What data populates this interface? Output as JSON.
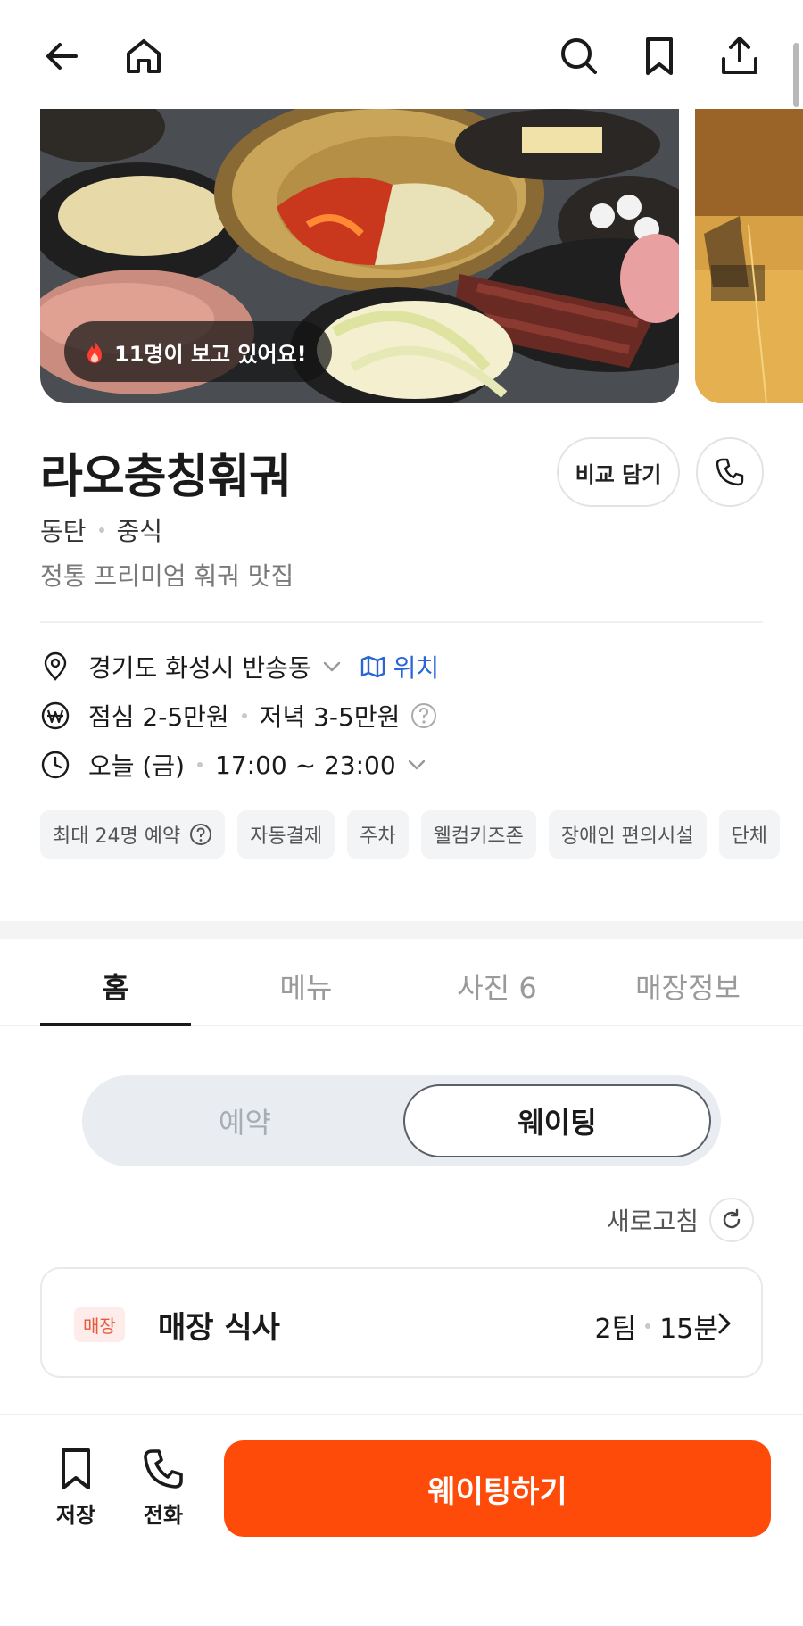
{
  "header": {
    "back_icon": "arrow-left-icon",
    "home_icon": "home-icon",
    "search_icon": "search-icon",
    "bookmark_icon": "bookmark-icon",
    "share_icon": "share-icon"
  },
  "gallery": {
    "viewer_badge": "11명이 보고 있어요!"
  },
  "restaurant": {
    "name": "라오충칭훠궈",
    "area": "동탄",
    "category": "중식",
    "tagline": "정통 프리미엄 훠궈 맛집",
    "compare_button": "비교 담기"
  },
  "info": {
    "address": "경기도 화성시 반송동",
    "map_link": "위치",
    "lunch_price": "점심 2-5만원",
    "dinner_price": "저녁 3-5만원",
    "today": "오늘 (금)",
    "hours": "17:00 ~ 23:00"
  },
  "chips": [
    "최대 24명 예약",
    "자동결제",
    "주차",
    "웰컴키즈존",
    "장애인 편의시설",
    "단체"
  ],
  "tabs": [
    "홈",
    "메뉴",
    "사진 6",
    "매장정보"
  ],
  "active_tab": "홈",
  "segment": {
    "reservation": "예약",
    "waiting": "웨이팅",
    "selected": "웨이팅"
  },
  "refresh_label": "새로고침",
  "wait_card": {
    "badge": "매장",
    "title": "매장 식사",
    "teams": "2팀",
    "time": "15분"
  },
  "bottom_bar": {
    "save_label": "저장",
    "call_label": "전화",
    "cta_label": "웨이팅하기"
  },
  "colors": {
    "accent": "#ff4b0a",
    "link": "#2866d8",
    "badge_text": "#e55a3c"
  }
}
